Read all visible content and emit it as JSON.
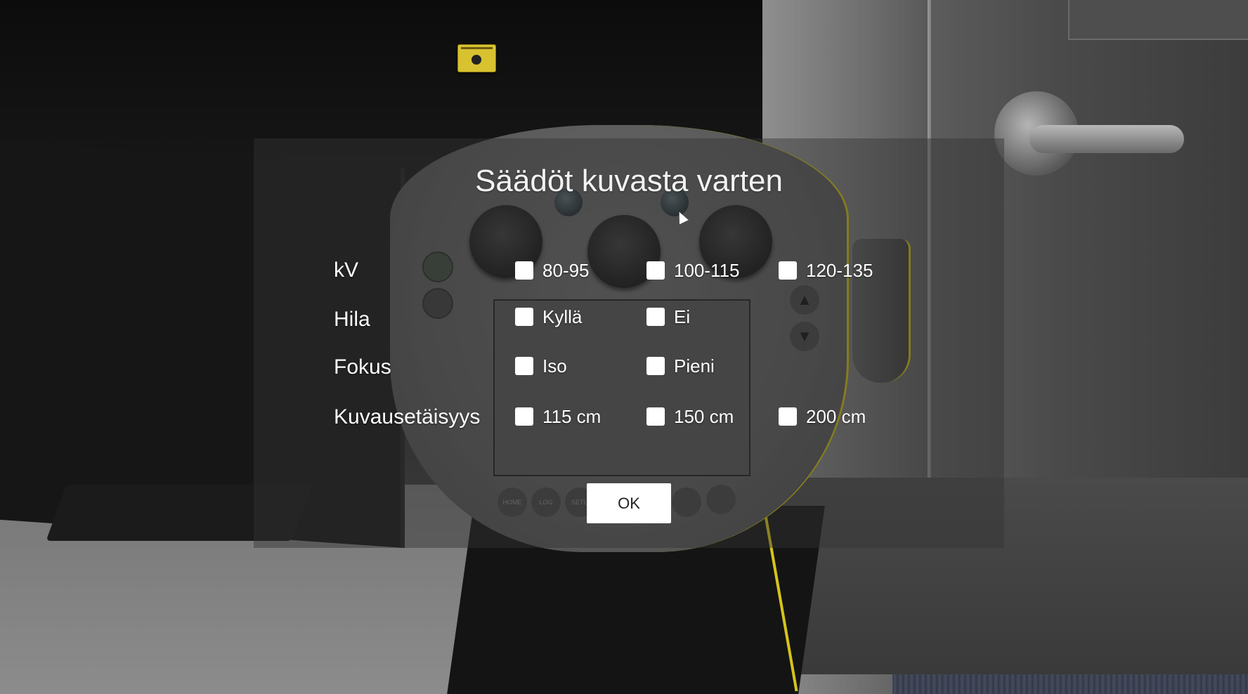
{
  "dialog": {
    "title": "Säädöt kuvasta varten",
    "ok_label": "OK"
  },
  "rows": [
    {
      "label": "kV",
      "options": [
        "80-95",
        "100-115",
        "120-135"
      ]
    },
    {
      "label": "Hila",
      "options": [
        "Kyllä",
        "Ei"
      ]
    },
    {
      "label": "Fokus",
      "options": [
        "Iso",
        "Pieni"
      ]
    },
    {
      "label": "Kuvausetäisyys",
      "options": [
        "115 cm",
        "150 cm",
        "200 cm"
      ]
    }
  ],
  "pendant": {
    "bottom_buttons": [
      "HOME",
      "LOG",
      "SETU"
    ]
  },
  "colors": {
    "checkbox": "#ffffff",
    "overlay": "#323232",
    "accent_yellow": "#d6c41a"
  },
  "icons": {
    "warning_sign": "radiation-warning-icon",
    "cursor": "mouse-cursor-icon"
  }
}
